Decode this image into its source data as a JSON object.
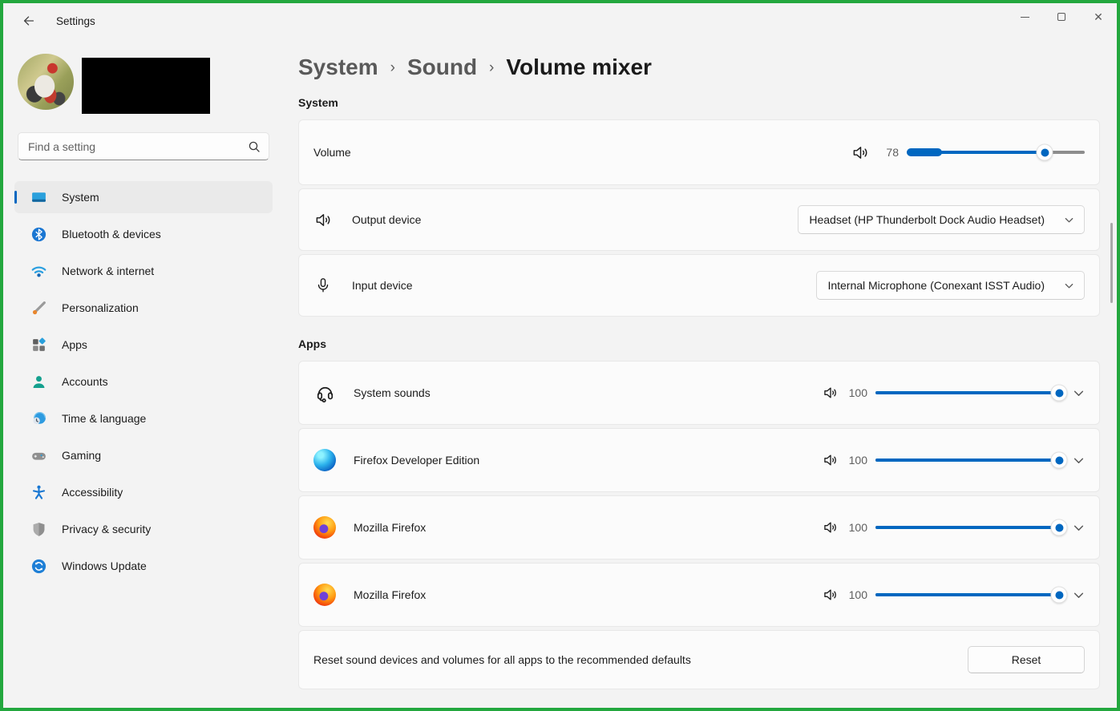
{
  "window": {
    "title": "Settings"
  },
  "titlebar": {
    "controls": [
      "minimize",
      "maximize",
      "close"
    ]
  },
  "sidebar": {
    "search_placeholder": "Find a setting",
    "items": [
      {
        "label": "System",
        "icon": "system-icon",
        "selected": true
      },
      {
        "label": "Bluetooth & devices",
        "icon": "bluetooth-icon",
        "selected": false
      },
      {
        "label": "Network & internet",
        "icon": "network-icon",
        "selected": false
      },
      {
        "label": "Personalization",
        "icon": "personalization-icon",
        "selected": false
      },
      {
        "label": "Apps",
        "icon": "apps-icon",
        "selected": false
      },
      {
        "label": "Accounts",
        "icon": "accounts-icon",
        "selected": false
      },
      {
        "label": "Time & language",
        "icon": "time-language-icon",
        "selected": false
      },
      {
        "label": "Gaming",
        "icon": "gaming-icon",
        "selected": false
      },
      {
        "label": "Accessibility",
        "icon": "accessibility-icon",
        "selected": false
      },
      {
        "label": "Privacy & security",
        "icon": "privacy-security-icon",
        "selected": false
      },
      {
        "label": "Windows Update",
        "icon": "windows-update-icon",
        "selected": false
      }
    ]
  },
  "breadcrumb": {
    "items": [
      "System",
      "Sound",
      "Volume mixer"
    ]
  },
  "sections": {
    "system": "System",
    "apps": "Apps"
  },
  "system": {
    "volume": {
      "label": "Volume",
      "value": "78",
      "percent": 78
    },
    "output": {
      "label": "Output device",
      "value": "Headset (HP Thunderbolt Dock Audio Headset)"
    },
    "input": {
      "label": "Input device",
      "value": "Internal Microphone (Conexant ISST Audio)"
    }
  },
  "apps": {
    "rows": [
      {
        "name": "System sounds",
        "value": "100",
        "percent": 100,
        "icon": "headset-icon"
      },
      {
        "name": "Firefox Developer Edition",
        "value": "100",
        "percent": 100,
        "icon": "firefox-developer-icon"
      },
      {
        "name": "Mozilla Firefox",
        "value": "100",
        "percent": 100,
        "icon": "firefox-icon"
      },
      {
        "name": "Mozilla Firefox",
        "value": "100",
        "percent": 100,
        "icon": "firefox-icon"
      }
    ]
  },
  "reset": {
    "description": "Reset sound devices and volumes for all apps to the recommended defaults",
    "button_label": "Reset"
  },
  "colors": {
    "accent": "#0067c0",
    "frame": "#23a73e",
    "card_bg": "#fbfbfb",
    "page_bg": "#f3f3f3"
  }
}
